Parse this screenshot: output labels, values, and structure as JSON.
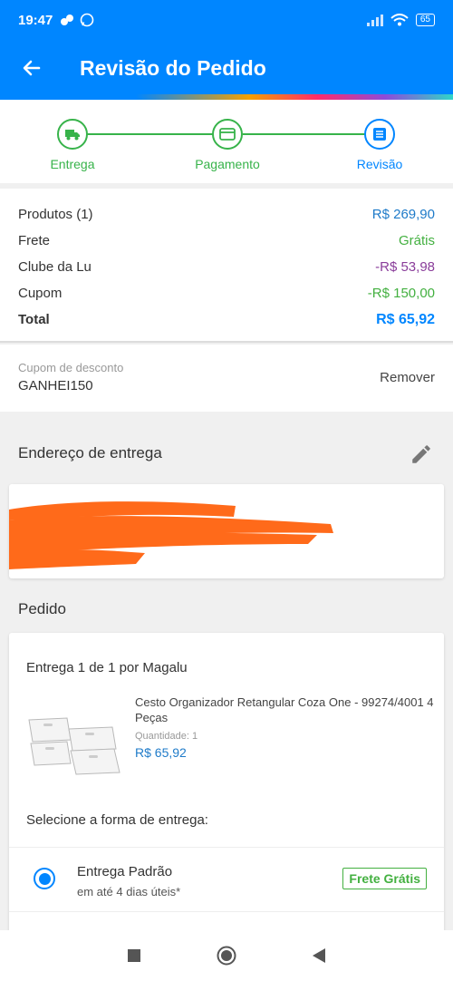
{
  "status_bar": {
    "time": "19:47",
    "battery": "65"
  },
  "header": {
    "title": "Revisão do Pedido"
  },
  "steps": [
    {
      "label": "Entrega",
      "icon": "truck-icon",
      "state": "done"
    },
    {
      "label": "Pagamento",
      "icon": "credit-card-icon",
      "state": "done"
    },
    {
      "label": "Revisão",
      "icon": "list-icon",
      "state": "active"
    }
  ],
  "summary": {
    "rows": [
      {
        "label": "Produtos (1)",
        "value": "R$ 269,90"
      },
      {
        "label": "Frete",
        "value": "Grátis"
      },
      {
        "label": "Clube da Lu",
        "value": "-R$ 53,98"
      },
      {
        "label": "Cupom",
        "value": "-R$ 150,00"
      }
    ],
    "total_label": "Total",
    "total_value": "R$ 65,92"
  },
  "coupon": {
    "label": "Cupom de desconto",
    "code": "GANHEI150",
    "remove_label": "Remover"
  },
  "address": {
    "section_title": "Endereço de entrega"
  },
  "order": {
    "section_title": "Pedido",
    "delivery_title": "Entrega 1 de 1 por Magalu",
    "product": {
      "name": "Cesto Organizador Retangular Coza One - 99274/4001 4 Peças",
      "quantity": "Quantidade: 1",
      "price": "R$ 65,92"
    },
    "select_label": "Selecione a forma de entrega:",
    "shipping_option": {
      "name": "Entrega Padrão",
      "eta": "em até 4 dias úteis*",
      "badge": "Frete Grátis"
    }
  },
  "colors": {
    "primary": "#0086ff",
    "green": "#37b34a",
    "purple": "#8a3d9a",
    "redaction": "#ff6a1a"
  }
}
